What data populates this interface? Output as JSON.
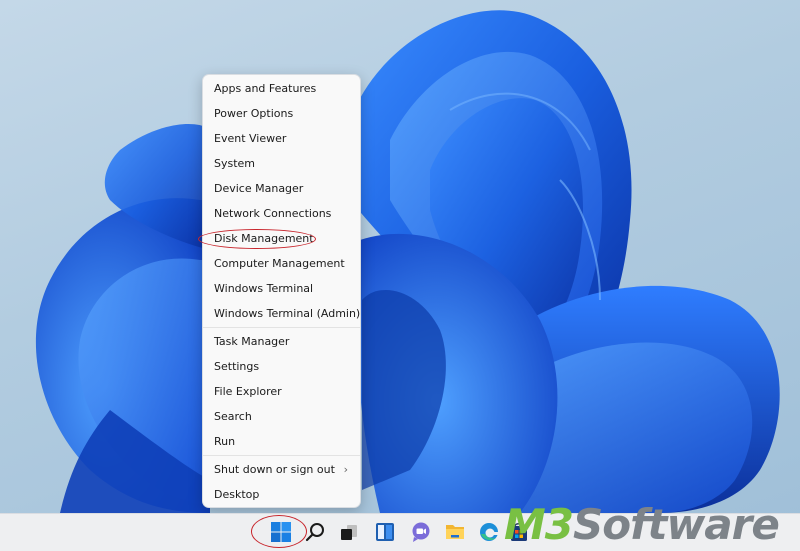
{
  "context_menu": {
    "groups": [
      [
        {
          "label": "Apps and Features"
        },
        {
          "label": "Power Options"
        },
        {
          "label": "Event Viewer"
        },
        {
          "label": "System"
        },
        {
          "label": "Device Manager"
        },
        {
          "label": "Network Connections"
        },
        {
          "label": "Disk Management",
          "highlighted": true
        },
        {
          "label": "Computer Management"
        },
        {
          "label": "Windows Terminal"
        },
        {
          "label": "Windows Terminal (Admin)"
        }
      ],
      [
        {
          "label": "Task Manager"
        },
        {
          "label": "Settings"
        },
        {
          "label": "File Explorer"
        },
        {
          "label": "Search"
        },
        {
          "label": "Run"
        }
      ],
      [
        {
          "label": "Shut down or sign out",
          "submenu": true,
          "arrow": "›"
        },
        {
          "label": "Desktop"
        }
      ]
    ]
  },
  "taskbar": {
    "icons": [
      {
        "name": "start-button",
        "icon": "windows-logo-icon",
        "highlighted": true
      },
      {
        "name": "search-button",
        "icon": "search-icon"
      },
      {
        "name": "task-view-button",
        "icon": "task-view-icon"
      },
      {
        "name": "widgets-button",
        "icon": "widgets-icon"
      },
      {
        "name": "teams-chat-button",
        "icon": "teams-chat-icon"
      },
      {
        "name": "file-explorer-button",
        "icon": "folder-icon"
      },
      {
        "name": "edge-button",
        "icon": "edge-icon"
      },
      {
        "name": "store-button",
        "icon": "store-icon"
      }
    ]
  },
  "watermark": {
    "part1": "M3",
    "part2": "Software",
    "color1": "#79c043",
    "color2": "#7d8389"
  },
  "colors": {
    "highlight_ring": "#c8262d",
    "menu_bg": "#f9f9f9",
    "taskbar_bg": "#eeeff1",
    "wallpaper_bloom": "#1a5fe0"
  }
}
